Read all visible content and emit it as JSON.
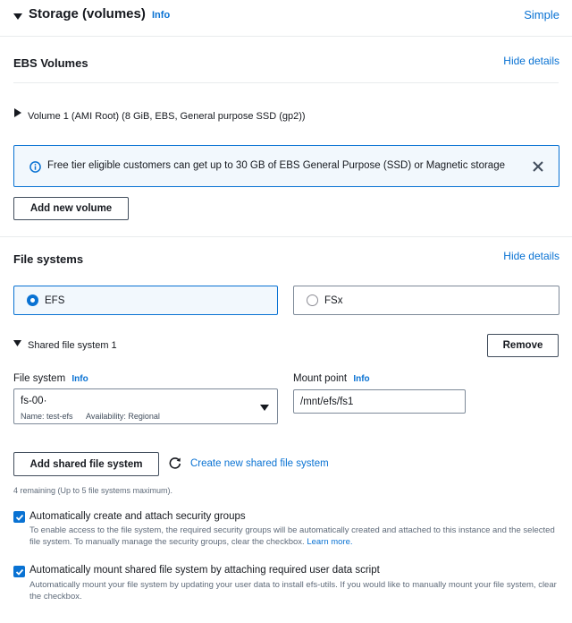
{
  "header": {
    "title": "Storage (volumes)",
    "info": "Info",
    "mode_link": "Simple"
  },
  "ebs": {
    "title": "EBS Volumes",
    "hide_details": "Hide details",
    "volume_label": "Volume 1 (AMI Root) (8 GiB, EBS, General purpose SSD (gp2))",
    "alert_text": "Free tier eligible customers can get up to 30 GB of EBS General Purpose (SSD) or Magnetic storage",
    "add_volume_label": "Add new volume"
  },
  "fs": {
    "title": "File systems",
    "hide_details": "Hide details",
    "options": [
      {
        "label": "EFS",
        "selected": true
      },
      {
        "label": "FSx",
        "selected": false
      }
    ],
    "shared_label": "Shared file system 1",
    "remove_label": "Remove",
    "file_system_label": "File system",
    "file_system_info": "Info",
    "file_system_value": "fs-00·",
    "file_system_name": "Name: test-efs",
    "file_system_availability": "Availability: Regional",
    "mount_point_label": "Mount point",
    "mount_point_info": "Info",
    "mount_point_value": "/mnt/efs/fs1",
    "add_shared_label": "Add shared file system",
    "create_new_label": "Create new shared file system",
    "remaining_text": "4 remaining (Up to 5 file systems maximum).",
    "auto_sg_label": "Automatically create and attach security groups",
    "auto_sg_desc": "To enable access to the file system, the required security groups will be automatically created and attached to this instance and the selected file system. To manually manage the security groups, clear the checkbox.",
    "learn_more": "Learn more.",
    "auto_mount_label": "Automatically mount shared file system by attaching required user data script",
    "auto_mount_desc": "Automatically mount your file system by updating your user data to install efs-utils. If you would like to manually mount your file system, clear the checkbox."
  },
  "colors": {
    "accent": "#0972d3",
    "alert_bg": "#f2f8fd",
    "selected_bg": "#f2f8fd"
  },
  "icons": [
    "caret-down-icon",
    "caret-right-icon",
    "info-circle-icon",
    "close-icon",
    "refresh-icon",
    "checkbox-checked-icon",
    "dropdown-arrow-icon"
  ]
}
